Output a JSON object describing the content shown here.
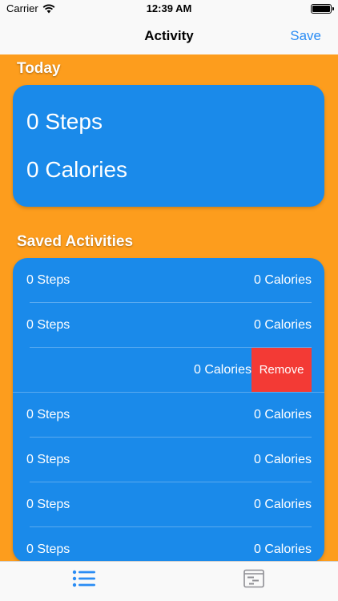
{
  "status_bar": {
    "carrier": "Carrier",
    "time": "12:39 AM",
    "battery_level": 1.0
  },
  "nav": {
    "title": "Activity",
    "save_label": "Save"
  },
  "colors": {
    "background": "#fd9d1d",
    "card": "#1a8aea",
    "accent": "#2a8cf4",
    "destructive": "#f33a35"
  },
  "today": {
    "title": "Today",
    "steps": "0 Steps",
    "calories": "0 Calories"
  },
  "saved": {
    "title": "Saved Activities",
    "rows": [
      {
        "steps": "0 Steps",
        "calories": "0 Calories"
      },
      {
        "steps": "0 Steps",
        "calories": "0 Calories"
      },
      {
        "steps": "",
        "calories": "0 Calories",
        "action": "Remove"
      },
      {
        "steps": "0 Steps",
        "calories": "0 Calories"
      },
      {
        "steps": "0 Steps",
        "calories": "0 Calories"
      },
      {
        "steps": "0 Steps",
        "calories": "0 Calories"
      },
      {
        "steps": "0 Steps",
        "calories": "0 Calories"
      }
    ]
  },
  "tabs": [
    {
      "icon": "list-icon",
      "selected": true
    },
    {
      "icon": "activity-icon",
      "selected": false
    }
  ]
}
